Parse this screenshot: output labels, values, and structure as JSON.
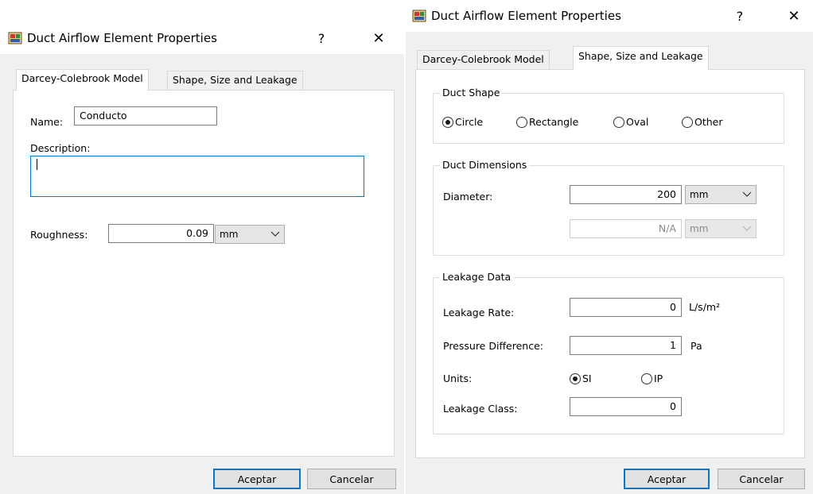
{
  "left_dialog": {
    "title": "Duct Airflow Element Properties",
    "help_label": "?",
    "close_label": "✕",
    "icon": "application-icon",
    "tabs": [
      {
        "label": "Darcey-Colebrook Model",
        "active": true
      },
      {
        "label": "Shape, Size and Leakage",
        "active": false
      }
    ],
    "name_label": "Name:",
    "name_value": "Conducto",
    "description_label": "Description:",
    "description_value": "",
    "roughness_label": "Roughness:",
    "roughness_value": "0.09",
    "roughness_unit": "mm",
    "ok_label": "Aceptar",
    "cancel_label": "Cancelar"
  },
  "right_dialog": {
    "title": "Duct Airflow Element Properties",
    "help_label": "?",
    "close_label": "✕",
    "icon": "application-icon",
    "tabs": [
      {
        "label": "Darcey-Colebrook Model",
        "active": false
      },
      {
        "label": "Shape, Size and Leakage",
        "active": true
      }
    ],
    "duct_shape": {
      "title": "Duct Shape",
      "options": [
        {
          "label": "Circle",
          "selected": true
        },
        {
          "label": "Rectangle",
          "selected": false
        },
        {
          "label": "Oval",
          "selected": false
        },
        {
          "label": "Other",
          "selected": false
        }
      ]
    },
    "duct_dimensions": {
      "title": "Duct Dimensions",
      "diameter_label": "Diameter:",
      "diameter_value": "200",
      "diameter_unit": "mm",
      "second_value": "N/A",
      "second_unit": "mm"
    },
    "leakage_data": {
      "title": "Leakage Data",
      "rate_label": "Leakage Rate:",
      "rate_value": "0",
      "rate_unit": "L/s/m²",
      "pressure_label": "Pressure Difference:",
      "pressure_value": "1",
      "pressure_unit": "Pa",
      "units_label": "Units:",
      "units_options": [
        {
          "label": "SI",
          "selected": true
        },
        {
          "label": "IP",
          "selected": false
        }
      ],
      "class_label": "Leakage Class:",
      "class_value": "0"
    },
    "ok_label": "Aceptar",
    "cancel_label": "Cancelar"
  },
  "colors": {
    "dialog_bg": "#f0f0f0",
    "pane_bg": "#ffffff",
    "focus_accent": "#0078d7",
    "button_bg": "#e1e1e1"
  }
}
